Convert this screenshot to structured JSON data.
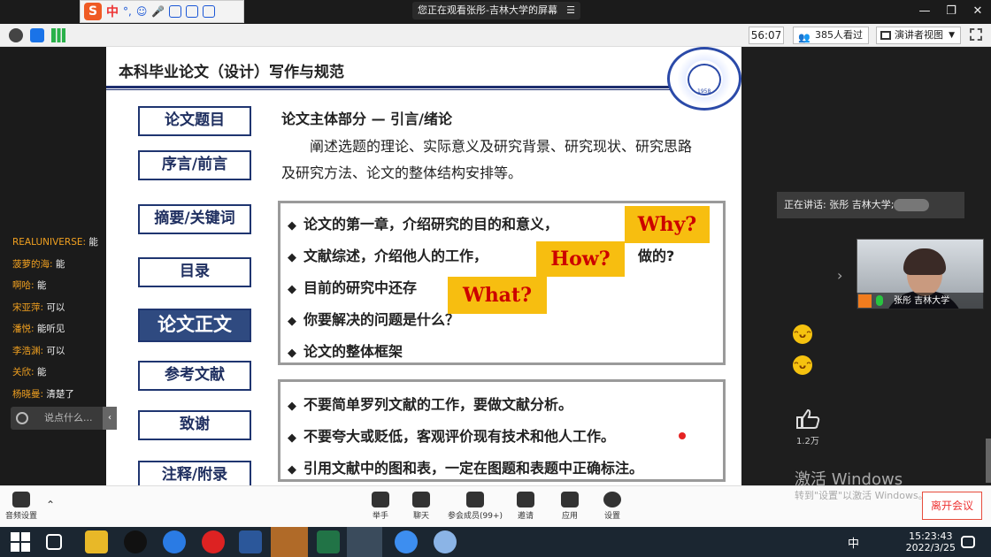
{
  "ime": {
    "logo": "S",
    "mode": "中"
  },
  "share_banner": {
    "text": "您正在观看张彤-吉林大学的屏幕",
    "menu": "☰"
  },
  "window_controls": [
    "—",
    "❐",
    "✕"
  ],
  "meeting": {
    "timer": "56:07",
    "viewers": "385人看过",
    "speaker_view": "演讲者视图"
  },
  "slide": {
    "title": "本科毕业论文（设计）写作与规范",
    "seal_year": "1958",
    "nav": [
      {
        "label": "论文题目",
        "active": false
      },
      {
        "label": "序言/前言",
        "active": false
      },
      {
        "label": "摘要/关键词",
        "active": false
      },
      {
        "label": "目录",
        "active": false
      },
      {
        "label": "论文正文",
        "active": true
      },
      {
        "label": "参考文献",
        "active": false
      },
      {
        "label": "致谢",
        "active": false
      },
      {
        "label": "注释/附录",
        "active": false
      }
    ],
    "heading": "论文主体部分 — 引言/绪论",
    "description": "阐述选题的理论、实际意义及研究背景、研究现状、研究思路及研究方法、论文的整体结构安排等。",
    "panel1": [
      "论文的第一章，介绍研究的目的和意义，",
      "文献综述，介绍他人的工作，",
      "目前的研究中还存",
      "你要解决的问题是什么？",
      "论文的整体框架"
    ],
    "panel1_tail": "做的?",
    "tags": {
      "why": "Why?",
      "how": "How?",
      "what": "What?"
    },
    "panel2": [
      "不要简单罗列文献的工作，要做文献分析。",
      "不要夸大或贬低，客观评价现有技术和他人工作。",
      "引用文献中的图和表，一定在图题和表题中正确标注。"
    ]
  },
  "chat": {
    "messages": [
      {
        "name": "REALUNIVERSE:",
        "text": "能"
      },
      {
        "name": "菠萝的海:",
        "text": "能"
      },
      {
        "name": "啊哈:",
        "text": "能"
      },
      {
        "name": "宋亚萍:",
        "text": "可以"
      },
      {
        "name": "潘悦:",
        "text": "能听见"
      },
      {
        "name": "李浩渊:",
        "text": "可以"
      },
      {
        "name": "关欣:",
        "text": "能"
      },
      {
        "name": "杨晓曼:",
        "text": "清楚了"
      }
    ],
    "input_placeholder": "说点什么..."
  },
  "speaking_now": "正在讲话: 张彤 吉林大学;",
  "video_label": "张彤 吉林大学",
  "like_count": "1.2万",
  "controls": {
    "audio": "音频设置",
    "buttons": [
      "举手",
      "聊天",
      "参会成员(99+)",
      "邀请",
      "应用",
      "设置"
    ],
    "leave": "离开会议"
  },
  "watermark": {
    "title": "激活 Windows",
    "sub": "转到\"设置\"以激活 Windows。"
  },
  "taskbar": {
    "ime": "中",
    "time": "15:23:43",
    "date": "2022/3/25"
  }
}
